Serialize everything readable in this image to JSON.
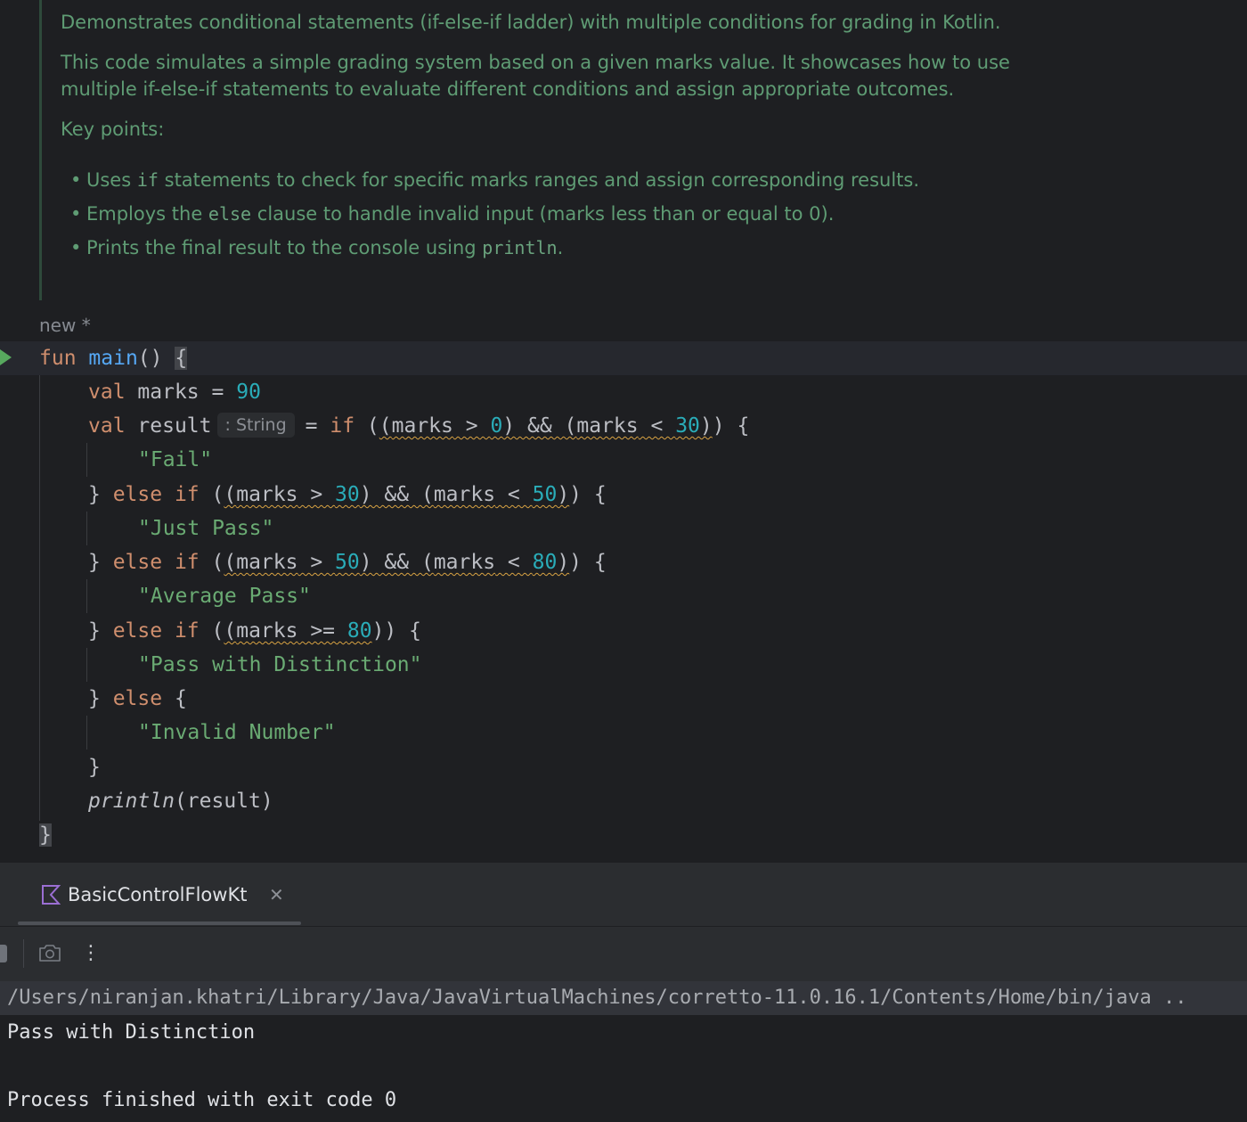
{
  "doc_comment": {
    "summary": "Demonstrates conditional statements (if-else-if ladder) with multiple conditions for grading in Kotlin.",
    "description_line1": "This code simulates a simple grading system based on a given marks value. It showcases how to use",
    "description_line2": "multiple if-else-if statements to evaluate different conditions and assign appropriate outcomes.",
    "key_points_heading": "Key points:",
    "points": [
      {
        "pre": "Uses ",
        "code": "if",
        "post": " statements to check for specific marks ranges and assign corresponding results."
      },
      {
        "pre": "Employs the ",
        "code": "else",
        "post": " clause to handle invalid input (marks less than or equal to 0)."
      },
      {
        "pre": "Prints the final result to the console using ",
        "code": "println",
        "post": "."
      }
    ]
  },
  "editor": {
    "author_label": "new *",
    "type_hint": ": String",
    "code": {
      "kw_fun": "fun",
      "fn_main": "main",
      "paren_pair": "()",
      "open_brace": "{",
      "close_brace": "}",
      "kw_val": "val",
      "var_marks": "marks",
      "var_result": "result",
      "assign": "=",
      "marks_value": "90",
      "kw_if": "if",
      "kw_else": "else",
      "str_fail": "\"Fail\"",
      "str_just_pass": "\"Just Pass\"",
      "str_average_pass": "\"Average Pass\"",
      "str_distinction": "\"Pass with Distinction\"",
      "str_invalid": "\"Invalid Number\"",
      "fn_println": "println",
      "println_arg": "(result)",
      "n0": "0",
      "n30": "30",
      "n50": "50",
      "n80": "80"
    }
  },
  "run_window": {
    "tab_label": "BasicControlFlowKt",
    "close_glyph": "✕",
    "more_glyph": "⋮",
    "icons": {
      "tab": "kotlin-icon",
      "camera": "camera-icon",
      "stop": "stop-icon",
      "more": "more-options-icon"
    }
  },
  "console": {
    "command": "/Users/niranjan.khatri/Library/Java/JavaVirtualMachines/corretto-11.0.16.1/Contents/Home/bin/java ..",
    "output": "Pass with Distinction",
    "exit_message": "Process finished with exit code 0"
  },
  "colors": {
    "background": "#1e1f22",
    "keyword": "#cf8e6d",
    "function": "#56a8f5",
    "number": "#2aacb8",
    "string": "#6aab73",
    "comment": "#5f9c74",
    "warning_underline": "#d9a343",
    "run_gutter": "#57a85e"
  }
}
